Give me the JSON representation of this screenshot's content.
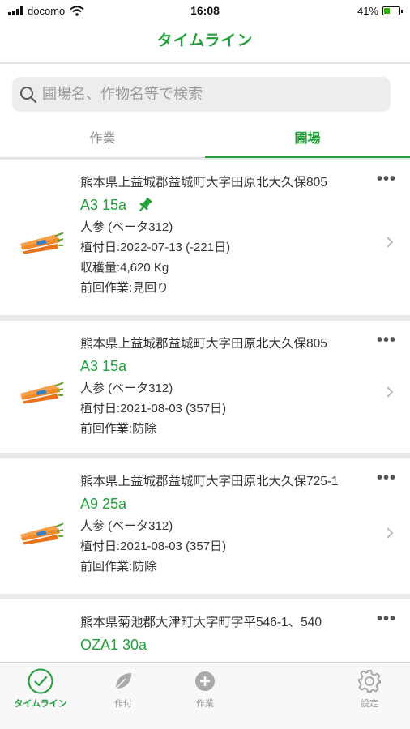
{
  "status_bar": {
    "carrier": "docomo",
    "time": "16:08",
    "battery_percent": "41%",
    "battery_level": 0.41
  },
  "nav": {
    "title": "タイムライン"
  },
  "search": {
    "placeholder": "圃場名、作物名等で検索"
  },
  "tabs": [
    {
      "label": "作業",
      "active": false
    },
    {
      "label": "圃場",
      "active": true
    }
  ],
  "fields": [
    {
      "address": "熊本県上益城郡益城町大字田原北大久保805",
      "name": "A3 15a",
      "pinned": true,
      "crop": "人参 (ベータ312)",
      "planting": "植付日:2022-07-13 (-221日)",
      "harvest": "収穫量:4,620 Kg",
      "last_work": "前回作業:見回り"
    },
    {
      "address": "熊本県上益城郡益城町大字田原北大久保805",
      "name": "A3 15a",
      "pinned": false,
      "crop": "人参 (ベータ312)",
      "planting": "植付日:2021-08-03 (357日)",
      "last_work": "前回作業:防除"
    },
    {
      "address": "熊本県上益城郡益城町大字田原北大久保725-1",
      "name": "A9 25a",
      "pinned": false,
      "crop": "人参 (ベータ312)",
      "planting": "植付日:2021-08-03 (357日)",
      "last_work": "前回作業:防除"
    },
    {
      "address": "熊本県菊池郡大津町大字町字平546-1、540",
      "name": "OZA1 30a",
      "pinned": false
    }
  ],
  "tab_bar": [
    {
      "label": "タイムライン",
      "icon": "check-circle-icon",
      "active": true
    },
    {
      "label": "作付",
      "icon": "leaf-icon",
      "active": false
    },
    {
      "label": "作業",
      "icon": "plus-circle-icon",
      "active": false
    },
    {
      "label": "設定",
      "icon": "gear-icon",
      "active": false
    }
  ],
  "colors": {
    "accent": "#21a03a",
    "carrot": "#f07a1a"
  }
}
